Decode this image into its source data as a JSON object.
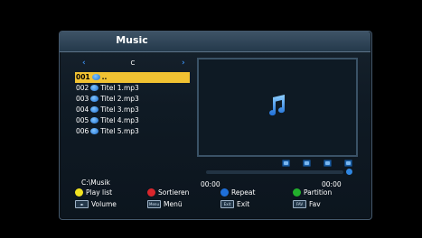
{
  "window": {
    "title": "Music"
  },
  "browser": {
    "current_dir": "C",
    "items": [
      {
        "num": "001",
        "name": "..",
        "selected": true
      },
      {
        "num": "002",
        "name": "Titel 1.mp3",
        "selected": false
      },
      {
        "num": "003",
        "name": "Titel 2.mp3",
        "selected": false
      },
      {
        "num": "004",
        "name": "Titel 3.mp3",
        "selected": false
      },
      {
        "num": "005",
        "name": "Titel 4.mp3",
        "selected": false
      },
      {
        "num": "006",
        "name": "Titel 5.mp3",
        "selected": false
      }
    ],
    "path": "C:\\Musik"
  },
  "player": {
    "time_current": "00:00",
    "time_total": "00:00",
    "progress": 0
  },
  "legend": {
    "yellow_label": "Play list",
    "red_label": "Sortieren",
    "blue_label": "Repeat",
    "green_label": "Partition",
    "volume_label": "Volume",
    "menu_key": "Menu",
    "menu_label": "Menü",
    "exit_key": "Exit",
    "exit_label": "Exit",
    "fav_key": "FAV",
    "fav_label": "Fav"
  },
  "colors": {
    "accent_blue": "#2f86e0",
    "selection": "#f1c232",
    "yellow": "#f1e221",
    "red": "#d9262c",
    "blue": "#1e6fd9",
    "green": "#22b02c"
  },
  "icons": {
    "preview": "music-note-icon",
    "file": "music-file-icon"
  }
}
